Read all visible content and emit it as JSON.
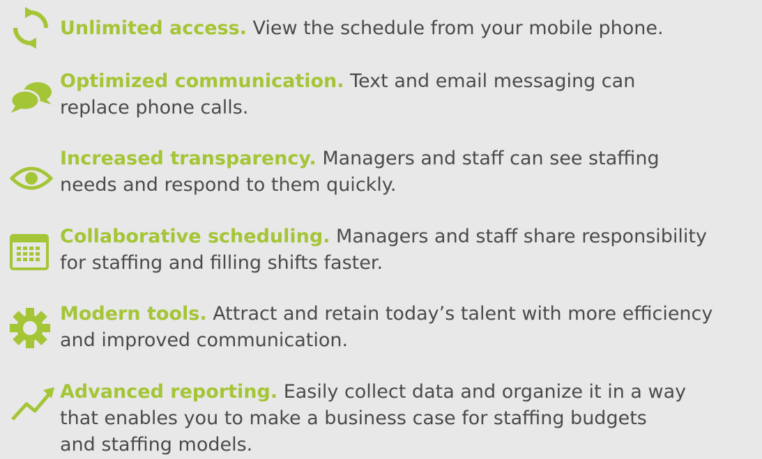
{
  "colors": {
    "background": "#e8e8e8",
    "accent": "#a4c536",
    "text": "#4a4a4a"
  },
  "features": [
    {
      "icon": "refresh-arrows-icon",
      "title": "Unlimited access.",
      "lines": [
        "View the schedule from your mobile phone."
      ]
    },
    {
      "icon": "chat-bubbles-icon",
      "title": "Optimized communication.",
      "lines": [
        "Text and email messaging can",
        "replace phone calls."
      ]
    },
    {
      "icon": "eye-icon",
      "title": "Increased transparency.",
      "lines": [
        "Managers and staff can see staffing",
        "needs and respond to them quickly."
      ]
    },
    {
      "icon": "calendar-icon",
      "title": "Collaborative scheduling.",
      "lines": [
        "Managers and staff share responsibility",
        "for staffing and filling shifts faster."
      ]
    },
    {
      "icon": "gear-icon",
      "title": "Modern tools.",
      "lines": [
        "Attract and retain today’s talent with more efficiency",
        "and improved communication."
      ]
    },
    {
      "icon": "trend-arrow-icon",
      "title": "Advanced reporting.",
      "lines": [
        "Easily collect data and organize it in a way",
        "that enables you to make a business case for staffing budgets",
        "and staffing models."
      ]
    }
  ]
}
